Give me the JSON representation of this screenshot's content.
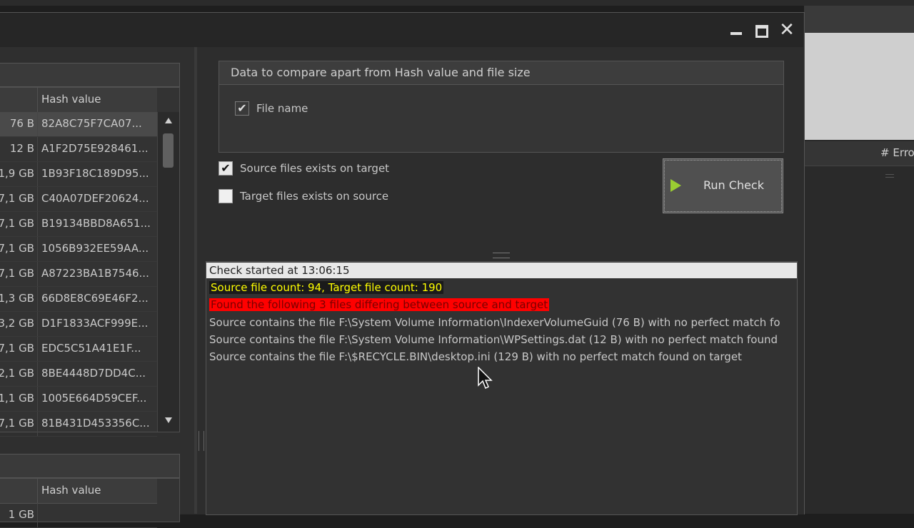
{
  "background_app": {
    "column_header": "# Erro"
  },
  "window": {
    "controls": {
      "minimize": "",
      "maximize": "",
      "close": "✕"
    }
  },
  "left_table_1": {
    "hash_header": "Hash value",
    "rows": [
      {
        "size": "76 B",
        "hash": "82A8C75F7CA07..."
      },
      {
        "size": "12 B",
        "hash": "A1F2D75E928461..."
      },
      {
        "size": "1,9 GB",
        "hash": "1B93F18C189D95..."
      },
      {
        "size": "7,1 GB",
        "hash": "C40A07DEF20624..."
      },
      {
        "size": "7,1 GB",
        "hash": "B19134BBD8A651..."
      },
      {
        "size": "7,1 GB",
        "hash": "1056B932EE59AA..."
      },
      {
        "size": "7,1 GB",
        "hash": "A87223BA1B7546..."
      },
      {
        "size": "1,3 GB",
        "hash": "66D8E8C69E46F2..."
      },
      {
        "size": "3,2 GB",
        "hash": "D1F1833ACF999E..."
      },
      {
        "size": "7,1 GB",
        "hash": "EDC5C51A41E1F..."
      },
      {
        "size": "2,1 GB",
        "hash": "8BE4448D7DD4C..."
      },
      {
        "size": "1,1 GB",
        "hash": "1005E664D59CEF..."
      },
      {
        "size": "7,1 GB",
        "hash": "81B431D453356C..."
      }
    ]
  },
  "left_table_2": {
    "hash_header": "Hash value",
    "rows": [
      {
        "size": "1 GB",
        "hash": ""
      }
    ]
  },
  "compare_box": {
    "title": "Data to compare apart from Hash value and file size",
    "file_name_label": "File name",
    "file_name_checked": true
  },
  "options": {
    "source_on_target_label": "Source files exists on target",
    "source_on_target_checked": true,
    "target_on_source_label": "Target files exists on source",
    "target_on_source_checked": false
  },
  "run_button": {
    "label": "Run Check"
  },
  "log": {
    "lines": [
      "Check started at 13:06:15",
      "Source file count: 94, Target file count: 190",
      "Found the following 3 files differing between source and target",
      "Source contains the file F:\\System Volume Information\\IndexerVolumeGuid (76 B) with no perfect match fo",
      "Source contains the file F:\\System Volume Information\\WPSettings.dat (12 B) with no perfect match found",
      "Source contains the file F:\\$RECYCLE.BIN\\desktop.ini (129 B) with no perfect match found on target"
    ]
  },
  "colors": {
    "highlight_yellow": "#ffff00",
    "highlight_red": "#ff0000",
    "play_icon": "#9acd32"
  }
}
